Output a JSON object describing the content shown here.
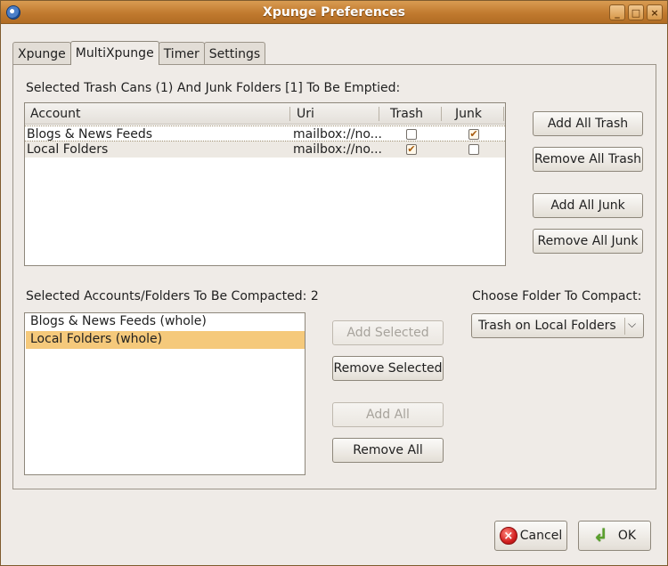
{
  "window": {
    "title": "Xpunge Preferences"
  },
  "tabs": [
    {
      "label": "Xpunge",
      "active": false
    },
    {
      "label": "MultiXpunge",
      "active": true
    },
    {
      "label": "Timer",
      "active": false
    },
    {
      "label": "Settings",
      "active": false
    }
  ],
  "empty_section": {
    "heading": "Selected Trash Cans (1) And Junk Folders [1] To Be Emptied:",
    "columns": [
      "Account",
      "Uri",
      "Trash",
      "Junk"
    ],
    "rows": [
      {
        "account": "Blogs & News Feeds",
        "uri": "mailbox://no...",
        "trash": false,
        "junk": true
      },
      {
        "account": "Local Folders",
        "uri": "mailbox://no...",
        "trash": true,
        "junk": false
      }
    ],
    "buttons": {
      "add_all_trash": "Add All Trash",
      "remove_all_trash": "Remove All Trash",
      "add_all_junk": "Add All Junk",
      "remove_all_junk": "Remove All Junk"
    }
  },
  "compact_section": {
    "heading": "Selected Accounts/Folders To Be Compacted: 2",
    "items": [
      {
        "label": "Blogs & News Feeds (whole)",
        "selected": false
      },
      {
        "label": "Local Folders (whole)",
        "selected": true
      }
    ],
    "buttons": {
      "add_selected": "Add Selected",
      "remove_selected": "Remove Selected",
      "add_all": "Add All",
      "remove_all": "Remove All"
    },
    "choose_label": "Choose Folder To Compact:",
    "choose_value": "Trash on Local Folders"
  },
  "footer": {
    "cancel": "Cancel",
    "ok": "OK"
  },
  "colors": {
    "titlebar": "#c17a2f",
    "selection": "#f5c97b",
    "window_bg": "#efebe7"
  }
}
